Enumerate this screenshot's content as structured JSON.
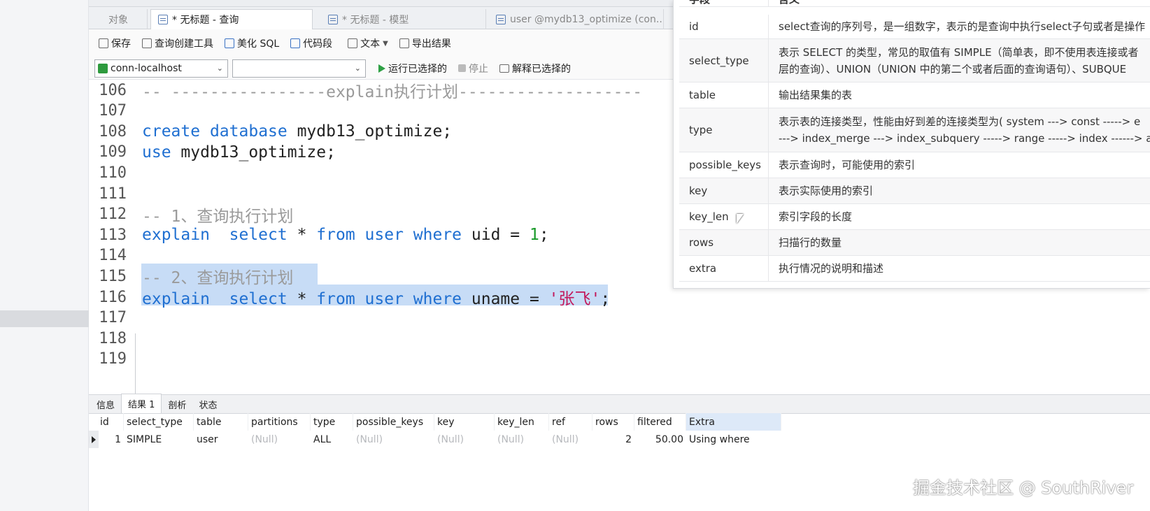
{
  "tabs": [
    {
      "label": "对象"
    },
    {
      "label": "* 无标题 - 查询"
    },
    {
      "label": "* 无标题 - 模型"
    },
    {
      "label": "user @mydb13_optimize (con..."
    }
  ],
  "toolbar": {
    "save": "保存",
    "query_builder": "查询创建工具",
    "beautify": "美化 SQL",
    "snippet": "代码段",
    "text": "文本",
    "export": "导出结果"
  },
  "connbar": {
    "connection": "conn-localhost",
    "database": "",
    "run_selected": "运行已选择的",
    "stop": "停止",
    "explain_selected": "解释已选择的"
  },
  "editor": {
    "lines": [
      {
        "n": "106",
        "segments": [
          {
            "t": "-- ----------------explain执行计划-------------------",
            "c": "cm"
          }
        ]
      },
      {
        "n": "107",
        "segments": []
      },
      {
        "n": "108",
        "segments": [
          {
            "t": "create",
            "c": "kw"
          },
          {
            "t": " ",
            "c": "plain"
          },
          {
            "t": "database",
            "c": "kw"
          },
          {
            "t": " mydb13_optimize;",
            "c": "plain"
          }
        ]
      },
      {
        "n": "109",
        "segments": [
          {
            "t": "use",
            "c": "kw"
          },
          {
            "t": " mydb13_optimize;",
            "c": "plain"
          }
        ]
      },
      {
        "n": "110",
        "segments": []
      },
      {
        "n": "111",
        "segments": []
      },
      {
        "n": "112",
        "segments": [
          {
            "t": "-- 1、查询执行计划",
            "c": "cm"
          }
        ]
      },
      {
        "n": "113",
        "segments": [
          {
            "t": "explain",
            "c": "kw"
          },
          {
            "t": "  ",
            "c": "plain"
          },
          {
            "t": "select",
            "c": "kw"
          },
          {
            "t": " * ",
            "c": "plain"
          },
          {
            "t": "from",
            "c": "kw"
          },
          {
            "t": " ",
            "c": "plain"
          },
          {
            "t": "user",
            "c": "kw"
          },
          {
            "t": " ",
            "c": "plain"
          },
          {
            "t": "where",
            "c": "kw"
          },
          {
            "t": " uid = ",
            "c": "plain"
          },
          {
            "t": "1",
            "c": "num"
          },
          {
            "t": ";",
            "c": "plain"
          }
        ]
      },
      {
        "n": "114",
        "segments": []
      },
      {
        "n": "115",
        "segments": [
          {
            "t": "-- 2、查询执行计划",
            "c": "cm"
          }
        ]
      },
      {
        "n": "116",
        "segments": [
          {
            "t": "explain",
            "c": "kw"
          },
          {
            "t": "  ",
            "c": "plain"
          },
          {
            "t": "select",
            "c": "kw"
          },
          {
            "t": " * ",
            "c": "plain"
          },
          {
            "t": "from",
            "c": "kw"
          },
          {
            "t": " ",
            "c": "plain"
          },
          {
            "t": "user",
            "c": "kw"
          },
          {
            "t": " ",
            "c": "plain"
          },
          {
            "t": "where",
            "c": "kw"
          },
          {
            "t": " uname = ",
            "c": "plain"
          },
          {
            "t": "'张飞'",
            "c": "str"
          },
          {
            "t": ";",
            "c": "plain"
          }
        ]
      },
      {
        "n": "117",
        "segments": []
      },
      {
        "n": "118",
        "segments": []
      },
      {
        "n": "119",
        "segments": []
      }
    ]
  },
  "result_tabs": [
    "信息",
    "结果 1",
    "剖析",
    "状态"
  ],
  "grid": {
    "columns": [
      "id",
      "select_type",
      "table",
      "partitions",
      "type",
      "possible_keys",
      "key",
      "key_len",
      "ref",
      "rows",
      "filtered",
      "Extra"
    ],
    "rows": [
      [
        "1",
        "SIMPLE",
        "user",
        "(Null)",
        "ALL",
        "(Null)",
        "(Null)",
        "(Null)",
        "(Null)",
        "2",
        "50.00",
        "Using where"
      ]
    ]
  },
  "overlay": {
    "header": [
      "字段",
      "含义"
    ],
    "rows": [
      {
        "field": "id",
        "meaning": [
          "select查询的序列号，是一组数字，表示的是查询中执行select子句或者是操作"
        ]
      },
      {
        "field": "select_type",
        "meaning": [
          "表示 SELECT 的类型，常见的取值有 SIMPLE（简单表，即不使用表连接或者",
          "层的查询）、UNION（UNION 中的第二个或者后面的查询语句）、SUBQUE"
        ]
      },
      {
        "field": "table",
        "meaning": [
          "输出结果集的表"
        ]
      },
      {
        "field": "type",
        "meaning": [
          "表示表的连接类型，性能由好到差的连接类型为( system ---> const -----> e",
          "---> index_merge ---> index_subquery -----> range -----> index ------> a"
        ]
      },
      {
        "field": "possible_keys",
        "meaning": [
          "表示查询时，可能使用的索引"
        ]
      },
      {
        "field": "key",
        "meaning": [
          "表示实际使用的索引"
        ]
      },
      {
        "field": "key_len",
        "meaning": [
          "索引字段的长度"
        ]
      },
      {
        "field": "rows",
        "meaning": [
          "扫描行的数量"
        ]
      },
      {
        "field": "extra",
        "meaning": [
          "执行情况的说明和描述"
        ]
      }
    ]
  },
  "watermark": "掘金技术社区 @ SouthRiver"
}
